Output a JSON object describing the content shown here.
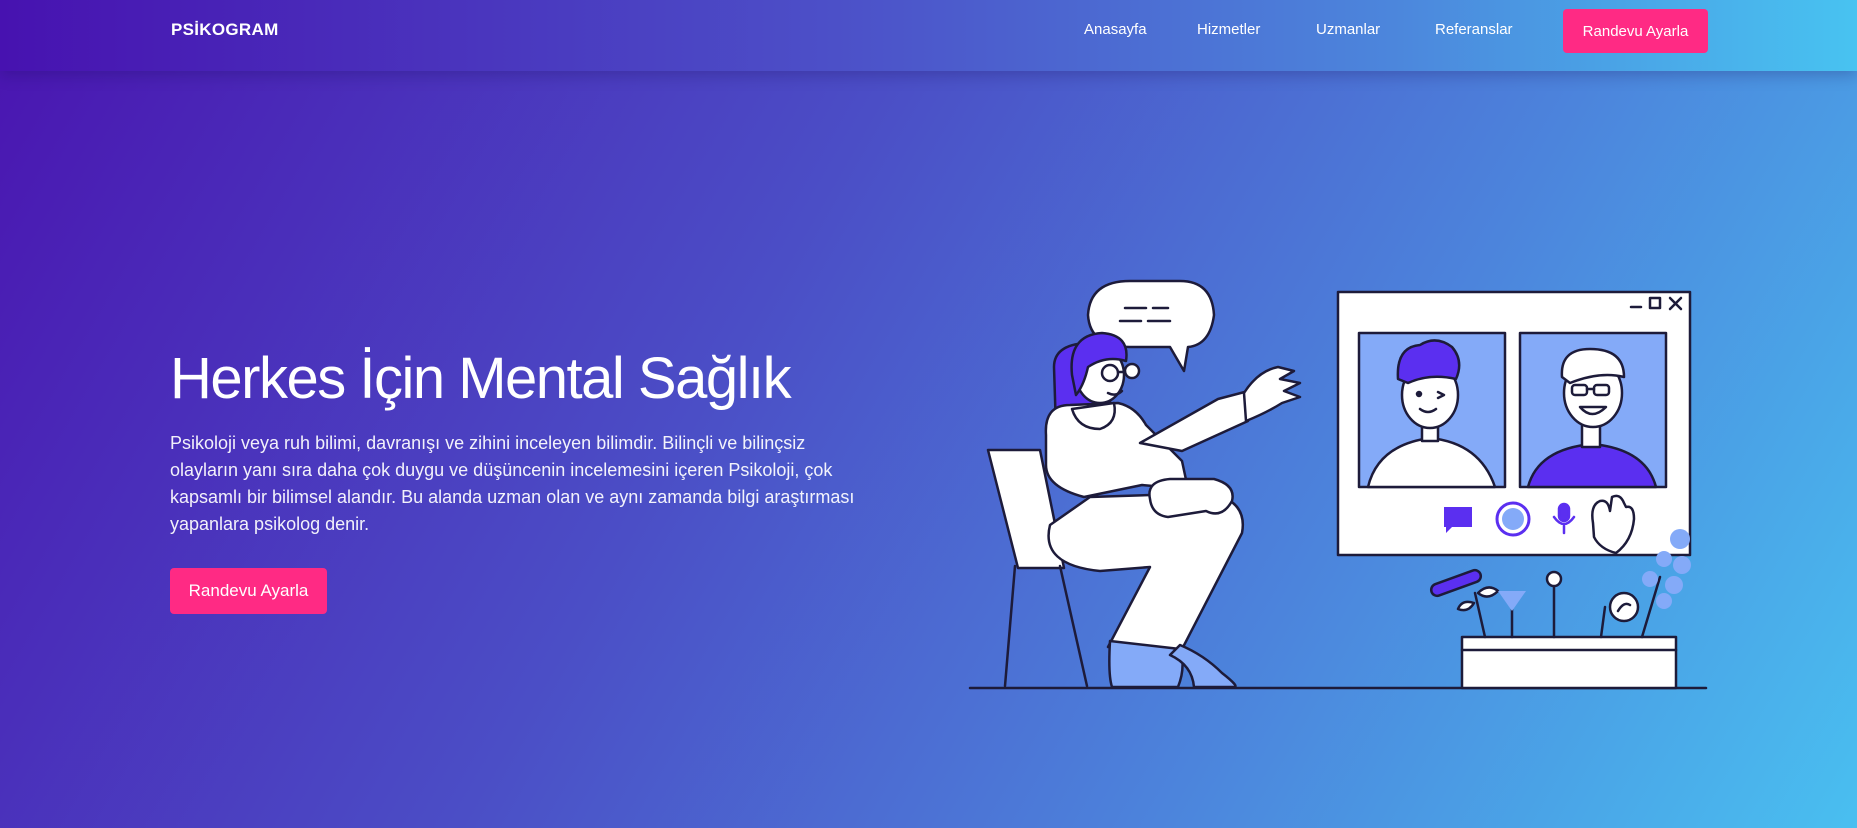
{
  "brand": {
    "name": "PSİKOGRAM"
  },
  "nav": {
    "items": [
      {
        "label": "Anasayfa"
      },
      {
        "label": "Hizmetler"
      },
      {
        "label": "Uzmanlar"
      },
      {
        "label": "Referanslar"
      }
    ],
    "cta_label": "Randevu Ayarla"
  },
  "hero": {
    "title": "Herkes İçin Mental Sağlık",
    "description": "Psikoloji veya ruh bilimi, davranışı ve zihini inceleyen bilimdir. Bilinçli ve bilinçsiz olayların yanı sıra daha çok duygu ve düşüncenin incelemesini içeren Psikoloji, çok kapsamlı bir bilimsel alandır. Bu alanda uzman olan ve aynı zamanda bilgi araştırması yapanlara psikolog denir.",
    "cta_label": "Randevu Ayarla"
  },
  "colors": {
    "accent": "#ff2a84",
    "gradient_start": "#4712b0",
    "gradient_end": "#48c3f1",
    "illustration_purple": "#5b2ff0",
    "illustration_light_blue": "#84aaf8"
  },
  "icons": [
    "window-minimize-icon",
    "window-maximize-icon",
    "window-close-icon",
    "chat-icon",
    "record-icon",
    "microphone-icon"
  ]
}
